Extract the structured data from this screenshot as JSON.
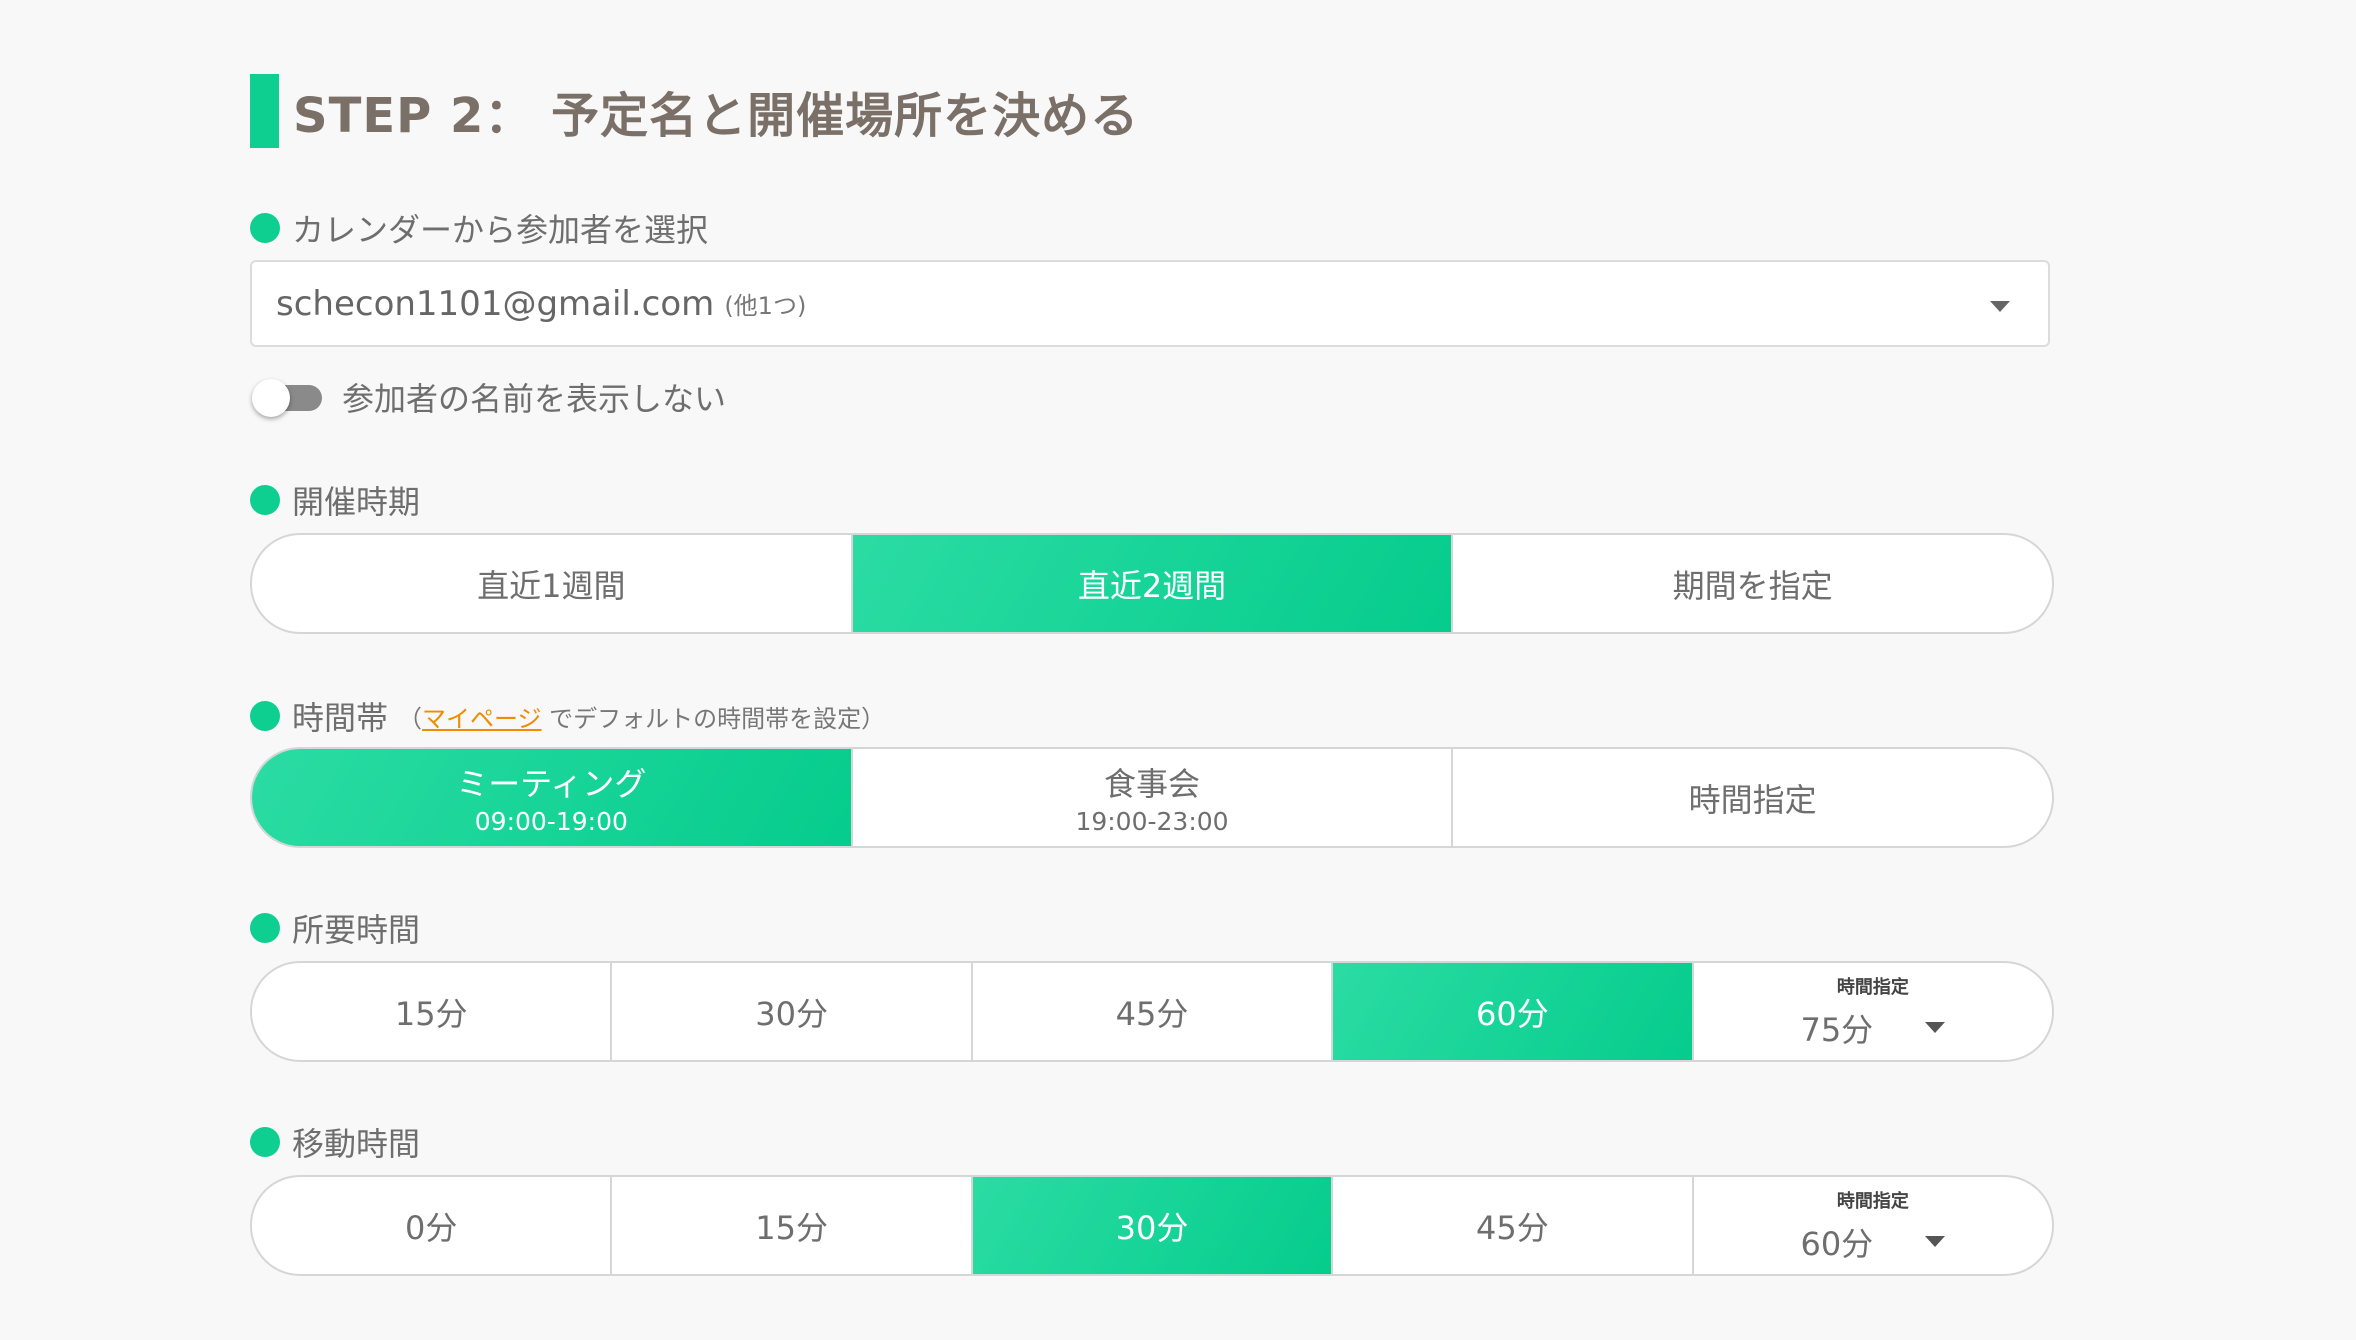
{
  "heading": {
    "title": "STEP 2： 予定名と開催場所を決める"
  },
  "calendar": {
    "label": "カレンダーから参加者を選択",
    "selected": "schecon1101@gmail.com",
    "extra": "(他1つ)"
  },
  "hide_names": {
    "label": "参加者の名前を表示しない",
    "on": false
  },
  "period": {
    "label": "開催時期",
    "options": [
      "直近1週間",
      "直近2週間",
      "期間を指定"
    ],
    "selected": "直近2週間"
  },
  "timeslot": {
    "label": "時間帯",
    "note_prefix": "（",
    "note_link": "マイページ",
    "note_suffix": " でデフォルトの時間帯を設定）",
    "options": [
      {
        "label": "ミーティング",
        "range": "09:00-19:00"
      },
      {
        "label": "食事会",
        "range": "19:00-23:00"
      },
      {
        "label": "時間指定",
        "range": ""
      }
    ],
    "selected": "ミーティング"
  },
  "duration": {
    "label": "所要時間",
    "options": [
      "15分",
      "30分",
      "45分",
      "60分"
    ],
    "selected": "60分",
    "custom_caption": "時間指定",
    "custom_value": "75分"
  },
  "travel": {
    "label": "移動時間",
    "options": [
      "0分",
      "15分",
      "30分",
      "45分"
    ],
    "selected": "30分",
    "custom_caption": "時間指定",
    "custom_value": "60分"
  },
  "colors": {
    "accent": "#0ecf8f",
    "link": "#f08c00",
    "heading": "#7a7068"
  },
  "icons": {
    "select_caret": "caret-down-icon",
    "toggle": "toggle-switch"
  }
}
